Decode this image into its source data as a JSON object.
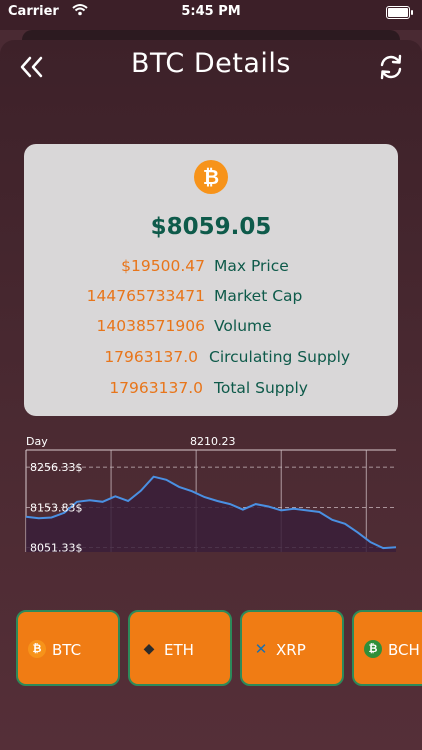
{
  "status_bar": {
    "carrier": "Carrier",
    "time": "5:45 PM"
  },
  "header": {
    "title": "BTC Details",
    "back_icon": "double-chevron-left-icon",
    "refresh_icon": "refresh-icon"
  },
  "coin": {
    "logo_symbol": "₿",
    "price": "$8059.05",
    "stats": [
      {
        "value": "$19500.47",
        "label": "Max Price"
      },
      {
        "value": "144765733471",
        "label": "Market Cap"
      },
      {
        "value": "14038571906",
        "label": "Volume"
      },
      {
        "value": "17963137.0",
        "label": "Circulating Supply"
      },
      {
        "value": "17963137.0",
        "label": "Total Supply"
      }
    ]
  },
  "chart_data": {
    "type": "area",
    "xlabel": "Day",
    "top_value_label": "8210.23",
    "y_tick_labels": [
      "8256.33$",
      "8153.83$",
      "8051.33$"
    ],
    "y_ticks": [
      8256.33,
      8153.83,
      8051.33
    ],
    "ylim": [
      8040,
      8300
    ],
    "grid": true,
    "line_color": "#4a90e2",
    "values": [
      8130,
      8126,
      8128,
      8140,
      8168,
      8172,
      8168,
      8182,
      8170,
      8196,
      8232,
      8224,
      8206,
      8195,
      8180,
      8170,
      8162,
      8148,
      8162,
      8156,
      8146,
      8150,
      8146,
      8142,
      8122,
      8112,
      8090,
      8065,
      8050,
      8052
    ]
  },
  "coins": [
    {
      "symbol": "BTC",
      "icon": "bitcoin-icon",
      "glyph": "₿"
    },
    {
      "symbol": "ETH",
      "icon": "ethereum-icon",
      "glyph": "◆"
    },
    {
      "symbol": "XRP",
      "icon": "xrp-icon",
      "glyph": "✕"
    },
    {
      "symbol": "BCH",
      "icon": "bitcoin-cash-icon",
      "glyph": "₿"
    }
  ],
  "colors": {
    "accent": "#f07c14",
    "price_green": "#0e5a4a",
    "value_orange": "#e8751a",
    "card_bg": "#d9d7d8"
  }
}
